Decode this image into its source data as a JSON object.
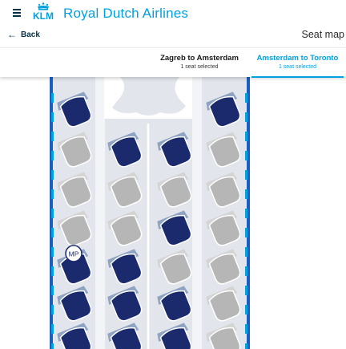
{
  "header": {
    "brand_text": "Royal Dutch Airlines",
    "logo_text": "KLM",
    "menu_icon": "hamburger-menu-icon",
    "brand_color": "#00a1de"
  },
  "subheader": {
    "back_label": "Back",
    "back_icon": "arrow-left-icon",
    "page_title": "Seat map"
  },
  "tabs": [
    {
      "label": "Zagreb to Amsterdam",
      "sub": "1 seat selected",
      "active": false
    },
    {
      "label": "Amsterdam to Toronto",
      "sub": "1 seat selected",
      "active": true
    }
  ],
  "seatmap": {
    "colors": {
      "occupied": "#1a2a6c",
      "available": "#b6b6b6",
      "cabin": "#e2e6ec",
      "accent": "#00a1de"
    },
    "columns": [
      "window-left",
      "aisle-left-middle",
      "middle-left",
      "middle-right",
      "window-right"
    ],
    "rows": [
      {
        "seats": [
          "occupied",
          "",
          "",
          "",
          "occupied"
        ]
      },
      {
        "seats": [
          "available",
          "occupied",
          "occupied",
          "",
          "available"
        ]
      },
      {
        "seats": [
          "available",
          "available",
          "available",
          "",
          "available"
        ]
      },
      {
        "seats": [
          "available",
          "available",
          "occupied",
          "",
          "available"
        ]
      },
      {
        "seats": [
          "occupied",
          "occupied",
          "available",
          "",
          "available"
        ]
      },
      {
        "seats": [
          "occupied",
          "occupied",
          "occupied",
          "",
          "available"
        ]
      },
      {
        "seats": [
          "occupied",
          "occupied",
          "occupied",
          "",
          "available"
        ]
      }
    ],
    "badge_text": "MP"
  }
}
